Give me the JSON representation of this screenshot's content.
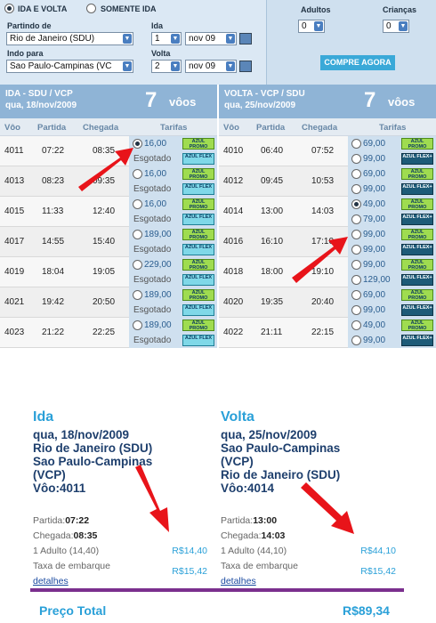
{
  "trip_type": {
    "round": "IDA E VOLTA",
    "oneway": "SOMENTE IDA"
  },
  "search": {
    "from_label": "Partindo de",
    "from_value": "Rio de Janeiro (SDU)",
    "to_label": "Indo para",
    "to_value": "Sao Paulo-Campinas (VC",
    "ida_label": "Ida",
    "ida_day": "1",
    "ida_month": "nov 09",
    "volta_label": "Volta",
    "volta_day": "2",
    "volta_month": "nov 09",
    "adults_label": "Adultos",
    "adults_value": "0",
    "children_label": "Crianças",
    "children_value": "0",
    "buy_button": "COMPRE AGORA"
  },
  "outbound": {
    "title": "IDA - SDU / VCP",
    "date": "qua, 18/nov/2009",
    "count": "7",
    "count_label": "vôos",
    "columns": [
      "Vôo",
      "Partida",
      "Chegada",
      "Tarifas"
    ],
    "rows": [
      {
        "flight": "4011",
        "dep": "07:22",
        "arr": "08:35",
        "fares": [
          {
            "value": "16,00",
            "badge": "promo",
            "selected": true
          },
          {
            "value": "Esgotado",
            "badge": "flex"
          }
        ]
      },
      {
        "flight": "4013",
        "dep": "08:23",
        "arr": "09:35",
        "fares": [
          {
            "value": "16,00",
            "badge": "promo"
          },
          {
            "value": "Esgotado",
            "badge": "flex"
          }
        ]
      },
      {
        "flight": "4015",
        "dep": "11:33",
        "arr": "12:40",
        "fares": [
          {
            "value": "16,00",
            "badge": "promo"
          },
          {
            "value": "Esgotado",
            "badge": "flex"
          }
        ]
      },
      {
        "flight": "4017",
        "dep": "14:55",
        "arr": "15:40",
        "fares": [
          {
            "value": "189,00",
            "badge": "promo"
          },
          {
            "value": "Esgotado",
            "badge": "flex"
          }
        ]
      },
      {
        "flight": "4019",
        "dep": "18:04",
        "arr": "19:05",
        "fares": [
          {
            "value": "229,00",
            "badge": "promo"
          },
          {
            "value": "Esgotado",
            "badge": "flex"
          }
        ]
      },
      {
        "flight": "4021",
        "dep": "19:42",
        "arr": "20:50",
        "fares": [
          {
            "value": "189,00",
            "badge": "promo"
          },
          {
            "value": "Esgotado",
            "badge": "flex"
          }
        ]
      },
      {
        "flight": "4023",
        "dep": "21:22",
        "arr": "22:25",
        "fares": [
          {
            "value": "189,00",
            "badge": "promo"
          },
          {
            "value": "Esgotado",
            "badge": "flex"
          }
        ]
      }
    ]
  },
  "inbound": {
    "title": "VOLTA - VCP / SDU",
    "date": "qua, 25/nov/2009",
    "count": "7",
    "count_label": "vôos",
    "columns": [
      "Vôo",
      "Partida",
      "Chegada",
      "Tarifas"
    ],
    "rows": [
      {
        "flight": "4010",
        "dep": "06:40",
        "arr": "07:52",
        "fares": [
          {
            "value": "69,00",
            "badge": "promo"
          },
          {
            "value": "99,00",
            "badge": "flexp"
          }
        ]
      },
      {
        "flight": "4012",
        "dep": "09:45",
        "arr": "10:53",
        "fares": [
          {
            "value": "69,00",
            "badge": "promo"
          },
          {
            "value": "99,00",
            "badge": "flexp"
          }
        ]
      },
      {
        "flight": "4014",
        "dep": "13:00",
        "arr": "14:03",
        "fares": [
          {
            "value": "49,00",
            "badge": "promo",
            "selected": true
          },
          {
            "value": "79,00",
            "badge": "flexp"
          }
        ]
      },
      {
        "flight": "4016",
        "dep": "16:10",
        "arr": "17:10",
        "fares": [
          {
            "value": "99,00",
            "badge": "promo"
          },
          {
            "value": "99,00",
            "badge": "flexp"
          }
        ]
      },
      {
        "flight": "4018",
        "dep": "18:00",
        "arr": "19:10",
        "fares": [
          {
            "value": "99,00",
            "badge": "promo"
          },
          {
            "value": "129,00",
            "badge": "flexp"
          }
        ]
      },
      {
        "flight": "4020",
        "dep": "19:35",
        "arr": "20:40",
        "fares": [
          {
            "value": "69,00",
            "badge": "promo"
          },
          {
            "value": "99,00",
            "badge": "flexp"
          }
        ]
      },
      {
        "flight": "4022",
        "dep": "21:11",
        "arr": "22:15",
        "fares": [
          {
            "value": "49,00",
            "badge": "promo"
          },
          {
            "value": "99,00",
            "badge": "flexp"
          }
        ]
      }
    ]
  },
  "badges": {
    "promo": "AZUL PROMO",
    "flex": "AZUL FLEX",
    "flexp": "AZUL FLEX+"
  },
  "summary": {
    "ida": {
      "heading": "Ida",
      "lines": [
        "qua, 18/nov/2009",
        "Rio de Janeiro (SDU)",
        "Sao Paulo-Campinas",
        "(VCP)",
        "Vôo:4011"
      ],
      "dep_label": "Partida:",
      "dep": "07:22",
      "arr_label": "Chegada:",
      "arr": "08:35",
      "adult": "1 Adulto  (14,40)",
      "adult_price": "R$14,40",
      "tax_label": "Taxa de embarque",
      "tax": "R$15,42",
      "details": "detalhes"
    },
    "volta": {
      "heading": "Volta",
      "lines": [
        "qua, 25/nov/2009",
        "Sao Paulo-Campinas",
        "(VCP)",
        "Rio de Janeiro (SDU)",
        "Vôo:4014"
      ],
      "dep_label": "Partida:",
      "dep": "13:00",
      "arr_label": "Chegada:",
      "arr": "14:03",
      "adult": "1 Adulto  (44,10)",
      "adult_price": "R$44,10",
      "tax_label": "Taxa de embarque",
      "tax": "R$15,42",
      "details": "detalhes"
    },
    "total_label": "Preço Total",
    "total": "R$89,34"
  },
  "colors": {
    "accent": "#2aa0d8",
    "arrow": "#e8141a",
    "header": "#8fb4d6"
  }
}
